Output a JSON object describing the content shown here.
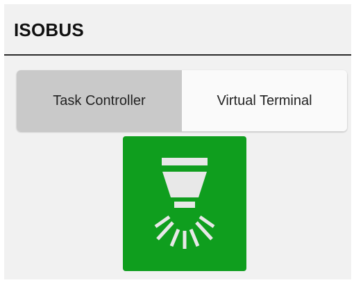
{
  "header": {
    "title": "ISOBUS"
  },
  "tabs": [
    {
      "label": "Task Controller",
      "selected": true
    },
    {
      "label": "Virtual Terminal",
      "selected": false
    }
  ],
  "spray_tile": {
    "icon": "nozzle-spray-icon",
    "color": "#0f9e1e"
  }
}
